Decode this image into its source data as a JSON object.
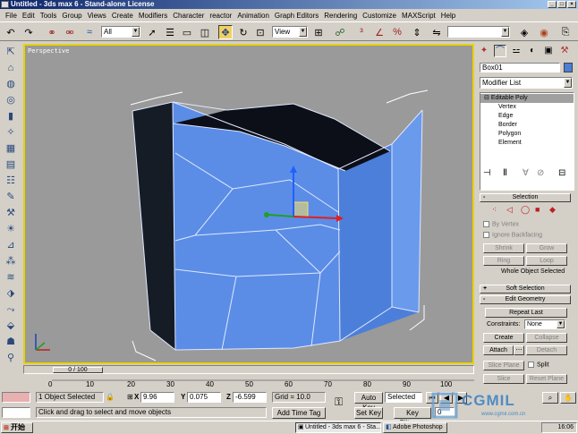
{
  "window": {
    "title": "Untitled - 3ds max 6 - Stand-alone License"
  },
  "menu": [
    "File",
    "Edit",
    "Tools",
    "Group",
    "Views",
    "Create",
    "Modifiers",
    "Character",
    "reactor",
    "Animation",
    "Graph Editors",
    "Rendering",
    "Customize",
    "MAXScript",
    "Help"
  ],
  "toolbar": {
    "selection_filter": "All",
    "ref_coord": "View"
  },
  "viewport": {
    "label": "Perspective"
  },
  "timeline": {
    "slider": "0 / 100",
    "ticks": [
      "0",
      "10",
      "20",
      "30",
      "40",
      "50",
      "60",
      "70",
      "80",
      "90",
      "100"
    ]
  },
  "status": {
    "selected": "1 Object Selected",
    "prompt": "Click and drag to select and move objects",
    "x_label": "X",
    "x": "9.96",
    "y_label": "Y",
    "y": "0.075",
    "z_label": "Z",
    "z": "-6.599",
    "grid": "Grid = 10.0",
    "add_time_tag": "Add Time Tag",
    "auto_key": "Auto Key",
    "set_key": "Set Key",
    "key_mode": "Selected",
    "key_filters": "Key Filters...",
    "frame": "0"
  },
  "command_panel": {
    "object_name": "Box01",
    "modifier_list": "Modifier List",
    "stack": [
      "Editable Poly",
      "Vertex",
      "Edge",
      "Border",
      "Polygon",
      "Element"
    ],
    "selection": {
      "title": "Selection",
      "by_vertex": "By Vertex",
      "ignore_backfacing": "Ignore Backfacing",
      "shrink": "Shrink",
      "grow": "Grow",
      "ring": "Ring",
      "loop": "Loop",
      "status": "Whole Object Selected"
    },
    "soft_selection": "Soft Selection",
    "edit_geometry": {
      "title": "Edit Geometry",
      "repeat_last": "Repeat Last",
      "constraints_label": "Constraints:",
      "constraints": "None",
      "create": "Create",
      "collapse": "Collapse",
      "attach": "Attach",
      "detach": "Detach",
      "slice_plane": "Slice Plane",
      "split": "Split",
      "slice": "Slice",
      "reset_plane": "Reset Plane"
    }
  },
  "taskbar": {
    "start": "开始",
    "tasks": [
      "Untitled - 3ds max 6 - Sta...",
      "Adobe Photoshop"
    ],
    "clock": "16:06"
  },
  "watermark": {
    "brand": "CGMIL",
    "url": "www.cgmil.com.cn"
  }
}
